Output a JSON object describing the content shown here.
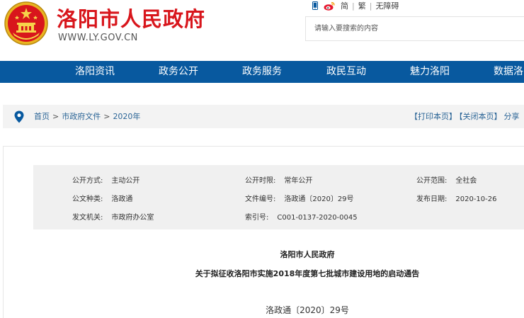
{
  "header": {
    "site_title": "洛阳市人民政府",
    "site_url": "WWW.LY.GOV.CN",
    "emblem_icon": "national-emblem-icon",
    "brand_color": "#d8161c",
    "tools": {
      "mobile_icon": "mobile-phone-icon",
      "weibo_icon": "weibo-icon",
      "simplified": "简",
      "traditional": "繁",
      "accessibility": "无障碍"
    },
    "search": {
      "placeholder": "请输入要搜索的内容"
    }
  },
  "nav": {
    "color": "#08599f",
    "items": [
      "洛阳资讯",
      "政务公开",
      "政务服务",
      "政民互动",
      "魅力洛阳",
      "数据洛阳"
    ]
  },
  "breadcrumb": {
    "icon": "location-pin-icon",
    "home": "首页",
    "sep": ">",
    "level1": "市政府文件",
    "level2": "2020年",
    "print": "【打印本页】",
    "close": "【关闭本页】",
    "share": "分享"
  },
  "meta": {
    "public_mode_label": "公开方式:",
    "public_mode": "主动公开",
    "public_period_label": "公开时限:",
    "public_period": "常年公开",
    "public_scope_label": "公开范围:",
    "public_scope": "全社会",
    "doc_type_label": "公文种类:",
    "doc_type": "洛政通",
    "doc_number_label": "文件编号:",
    "doc_number": "洛政通〔2020〕29号",
    "publish_date_label": "发布日期:",
    "publish_date": "2020-10-26",
    "issuer_label": "发文机关:",
    "issuer": "市政府办公室",
    "index_label": "索引号:",
    "index": "C001-0137-2020-0045"
  },
  "document": {
    "org": "洛阳市人民政府",
    "title": "关于拟征收洛阳市实施2018年度第七批城市建设用地的启动通告",
    "number": "洛政通〔2020〕29号"
  }
}
